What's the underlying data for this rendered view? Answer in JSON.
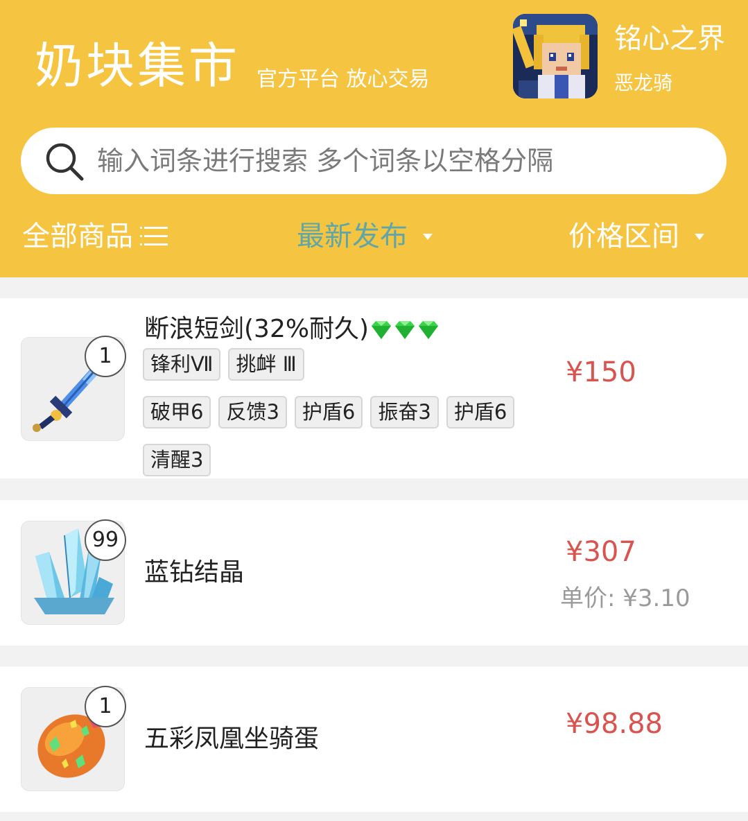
{
  "header": {
    "title": "奶块集市",
    "slogan": "官方平台 放心交易",
    "server_name": "铭心之界",
    "server_sub": "恶龙骑"
  },
  "search": {
    "placeholder": "输入词条进行搜索 多个词条以空格分隔"
  },
  "filters": {
    "all": "全部商品",
    "latest": "最新发布",
    "price_range": "价格区间"
  },
  "colors": {
    "header_bg": "#f5c542",
    "active_filter": "#5ea6a8",
    "price": "#d9534f"
  },
  "items": [
    {
      "name": "断浪短剑(32%耐久)",
      "quantity": "1",
      "icon": "sword-icon",
      "gem_icons": [
        "green-gem-icon",
        "green-gem-icon",
        "green-gem-icon"
      ],
      "tags": [
        "锋利Ⅶ",
        "挑衅 Ⅲ",
        "破甲6",
        "反馈3",
        "护盾6",
        "振奋3",
        "护盾6",
        "清醒3"
      ],
      "price": "¥150"
    },
    {
      "name": "蓝钻结晶",
      "quantity": "99",
      "icon": "blue-crystal-icon",
      "price": "¥307",
      "unit_price": "单价: ¥3.10"
    },
    {
      "name": "五彩凤凰坐骑蛋",
      "quantity": "1",
      "icon": "phoenix-egg-icon",
      "price": "¥98.88"
    }
  ]
}
